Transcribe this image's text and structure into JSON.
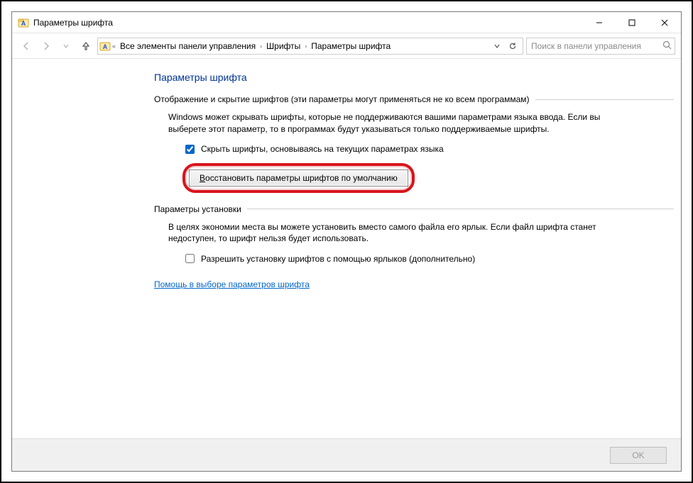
{
  "window": {
    "title": "Параметры шрифта"
  },
  "nav": {
    "breadcrumbs": [
      "Все элементы панели управления",
      "Шрифты",
      "Параметры шрифта"
    ],
    "search_placeholder": "Поиск в панели управления"
  },
  "content": {
    "page_title": "Параметры шрифта",
    "group1": {
      "label": "Отображение и скрытие шрифтов (эти параметры могут применяться не ко всем программам)",
      "desc": "Windows может скрывать шрифты, которые не поддерживаются вашими параметрами языка ввода. Если вы выберете этот параметр, то в программах будут указываться только поддерживаемые шрифты.",
      "check_label": "Скрыть шрифты, основываясь на текущих параметрах языка",
      "check_value": true,
      "button_prefix": "В",
      "button_rest": "осстановить параметры шрифтов по умолчанию"
    },
    "group2": {
      "label": "Параметры установки",
      "desc": "В целях экономии места вы можете установить вместо самого файла его ярлык. Если файл шрифта станет недоступен, то шрифт нельзя будет использовать.",
      "check_label": "Разрешить установку шрифтов с помощью ярлыков (дополнительно)",
      "check_value": false
    },
    "help_link": "Помощь в выборе параметров шрифта"
  },
  "footer": {
    "ok_label": "OK"
  }
}
